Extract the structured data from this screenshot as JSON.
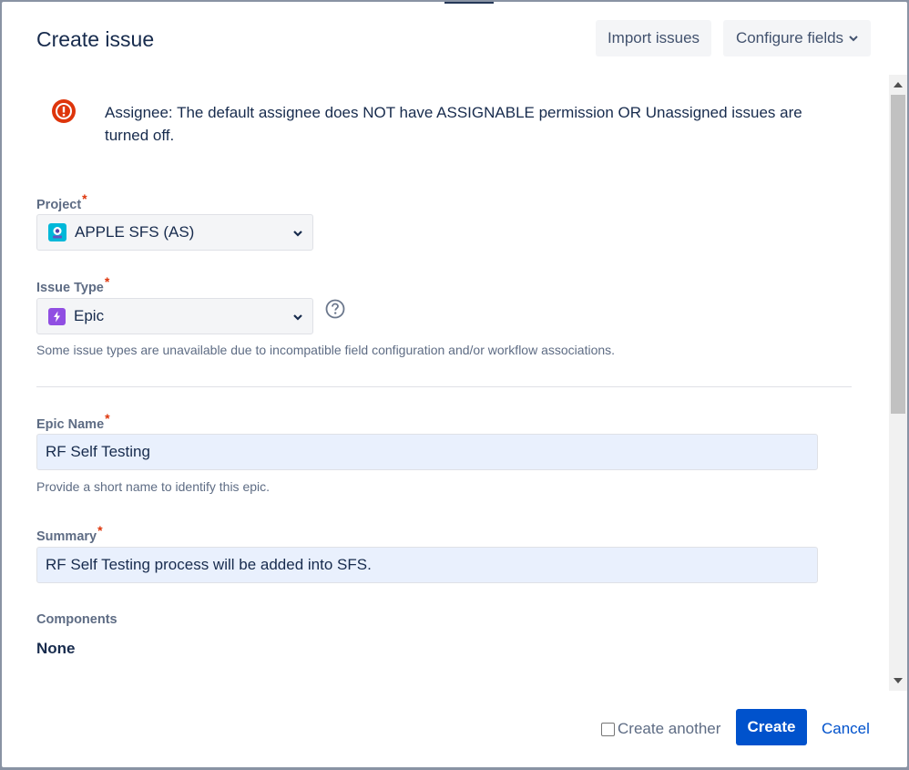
{
  "dialog": {
    "title": "Create issue",
    "import_label": "Import issues",
    "configure_label": "Configure fields"
  },
  "error": {
    "message": "Assignee: The default assignee does NOT have ASSIGNABLE permission OR Unassigned issues are turned off."
  },
  "fields": {
    "project": {
      "label": "Project",
      "value": "APPLE SFS (AS)"
    },
    "issue_type": {
      "label": "Issue Type",
      "value": "Epic",
      "note": "Some issue types are unavailable due to incompatible field configuration and/or workflow associations."
    },
    "epic_name": {
      "label": "Epic Name",
      "value": "RF Self Testing",
      "note": "Provide a short name to identify this epic."
    },
    "summary": {
      "label": "Summary",
      "value": "RF Self Testing process will be added into SFS."
    },
    "components": {
      "label": "Components",
      "value": "None"
    }
  },
  "required_marker": "*",
  "footer": {
    "create_another_label": "Create another",
    "create_label": "Create",
    "cancel_label": "Cancel"
  },
  "colors": {
    "primary": "#0052cc",
    "error": "#de350b",
    "epic": "#904ee2",
    "project": "#00b8d9"
  }
}
